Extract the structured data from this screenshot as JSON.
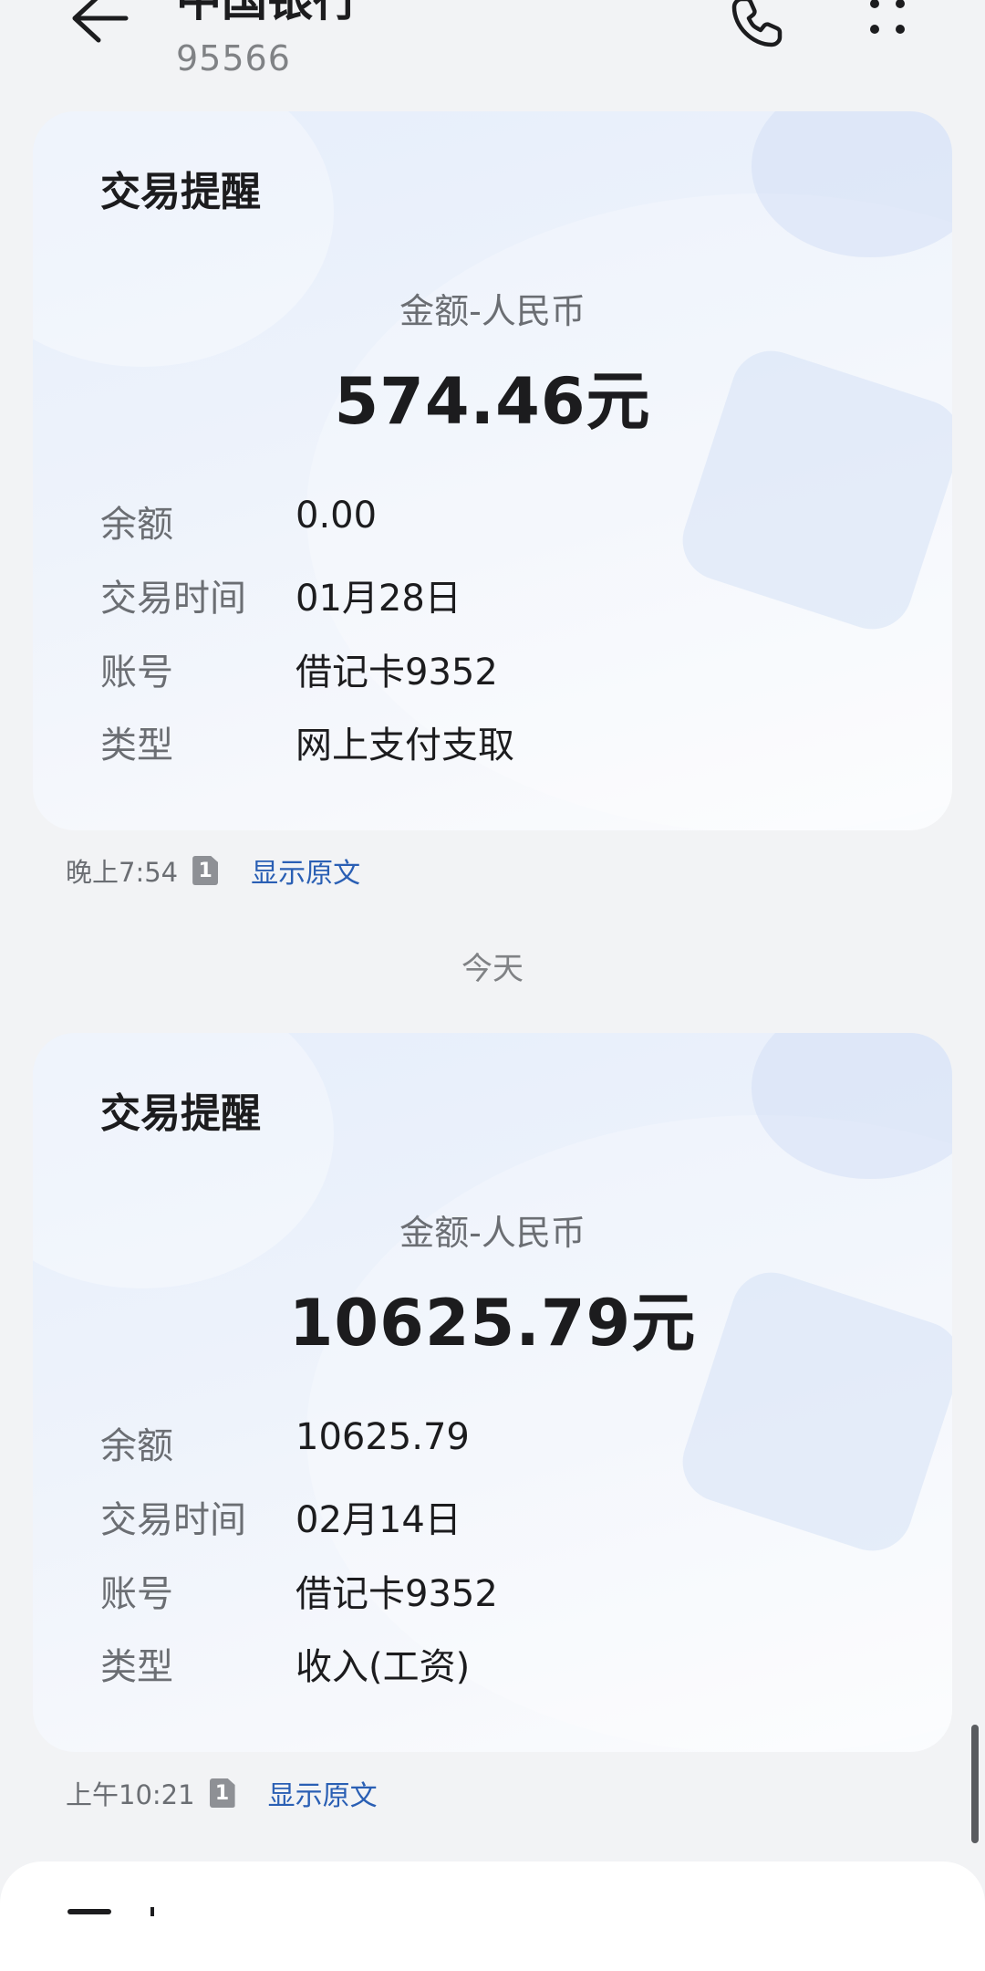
{
  "header": {
    "title": "中国银行",
    "number": "95566"
  },
  "messages": [
    {
      "card_title": "交易提醒",
      "amount_label": "金额-人民币",
      "amount": "574.46元",
      "rows": [
        {
          "label": "余额",
          "value": "0.00"
        },
        {
          "label": "交易时间",
          "value": "01月28日"
        },
        {
          "label": "账号",
          "value": "借记卡9352"
        },
        {
          "label": "类型",
          "value": "网上支付支取"
        }
      ],
      "time": "晚上7:54",
      "sim": "1",
      "show_original": "显示原文"
    },
    {
      "card_title": "交易提醒",
      "amount_label": "金额-人民币",
      "amount": "10625.79元",
      "rows": [
        {
          "label": "余额",
          "value": "10625.79"
        },
        {
          "label": "交易时间",
          "value": "02月14日"
        },
        {
          "label": "账号",
          "value": "借记卡9352"
        },
        {
          "label": "类型",
          "value": "收入(工资)"
        }
      ],
      "time": "上午10:21",
      "sim": "1",
      "show_original": "显示原文"
    }
  ],
  "date_divider": "今天",
  "colors": {
    "background": "#f2f3f5",
    "link": "#2a5fb4",
    "primary_text": "#1c1c1e",
    "secondary_text": "#6b6e73"
  },
  "icons": {
    "back": "back-arrow-icon",
    "phone": "phone-icon",
    "more": "more-vertical-icon"
  }
}
